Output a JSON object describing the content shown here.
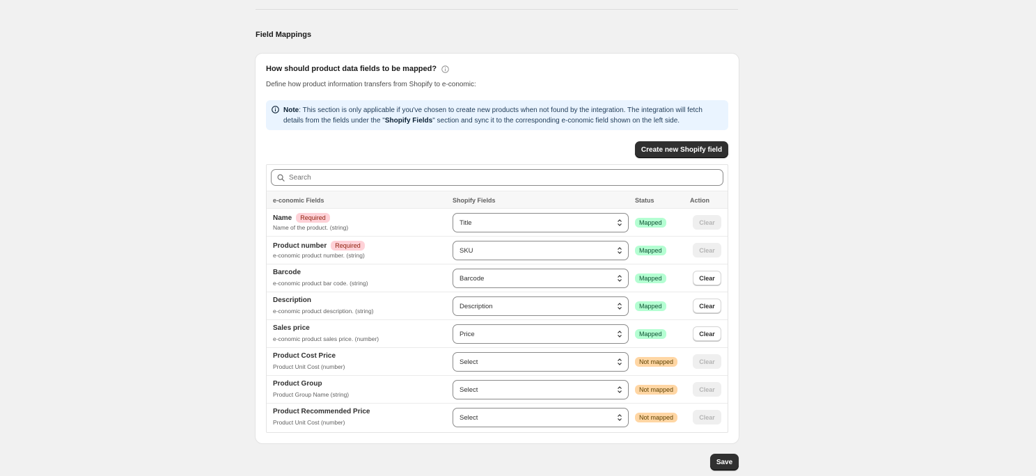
{
  "section": {
    "title": "Field Mappings"
  },
  "card": {
    "question": "How should product data fields to be mapped?",
    "description": "Define how product information transfers from Shopify to e-conomic:",
    "note": {
      "label": "Note",
      "text_1": ": This section is only applicable if you've chosen to create new products when not found by the integration. The integration will fetch details from the fields under the \"",
      "emphasis": "Shopify Fields",
      "text_2": "\" section and sync it to the corresponding e-conomic field shown on the left side."
    },
    "create_button": "Create new Shopify field"
  },
  "search": {
    "placeholder": "Search"
  },
  "table": {
    "headers": {
      "economic": "e-conomic Fields",
      "shopify": "Shopify Fields",
      "status": "Status",
      "action": "Action"
    },
    "rows": [
      {
        "name": "Name",
        "required": "Required",
        "desc": "Name of the product. (string)",
        "shopify": "Title",
        "status": "Mapped",
        "clear": "Clear"
      },
      {
        "name": "Product number",
        "required": "Required",
        "desc": "e-conomic product number. (string)",
        "shopify": "SKU",
        "status": "Mapped",
        "clear": "Clear"
      },
      {
        "name": "Barcode",
        "required": "",
        "desc": "e-conomic product bar code. (string)",
        "shopify": "Barcode",
        "status": "Mapped",
        "clear": "Clear"
      },
      {
        "name": "Description",
        "required": "",
        "desc": "e-conomic product description. (string)",
        "shopify": "Description",
        "status": "Mapped",
        "clear": "Clear"
      },
      {
        "name": "Sales price",
        "required": "",
        "desc": "e-conomic product sales price. (number)",
        "shopify": "Price",
        "status": "Mapped",
        "clear": "Clear"
      },
      {
        "name": "Product Cost Price",
        "required": "",
        "desc": "Product Unit Cost (number)",
        "shopify": "Select",
        "status": "Not mapped",
        "clear": "Clear"
      },
      {
        "name": "Product Group",
        "required": "",
        "desc": "Product Group Name (string)",
        "shopify": "Select",
        "status": "Not mapped",
        "clear": "Clear"
      },
      {
        "name": "Product Recommended Price",
        "required": "",
        "desc": "Product Unit Cost (number)",
        "shopify": "Select",
        "status": "Not mapped",
        "clear": "Clear"
      }
    ]
  },
  "save_button": "Save",
  "icons": {
    "question_info": "info-circle-icon",
    "note_info": "info-circle-icon",
    "search": "search-icon",
    "select_chevron": "chevron-up-down-icon"
  },
  "colors": {
    "primary_button": "#303030",
    "mapped_badge": "#b4fed2",
    "not_mapped_badge": "#ffd6a4",
    "required_badge": "#fed1d7",
    "note_background": "#eaf4ff"
  }
}
